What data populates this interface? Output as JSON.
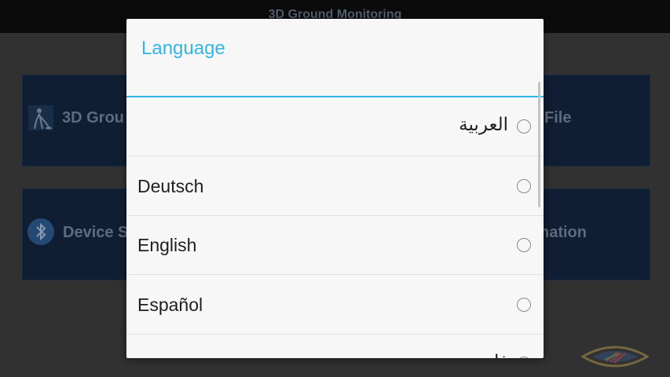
{
  "app": {
    "title": "3D Ground Monitoring"
  },
  "tiles": {
    "top_left_label": "3D Grou",
    "top_right_label": "File",
    "bottom_left_label": "Device S",
    "bottom_right_label": "nation"
  },
  "dialog": {
    "title": "Language",
    "options": [
      {
        "label": "العربية",
        "dir": "rtl",
        "selected": false
      },
      {
        "label": "Deutsch",
        "dir": "ltr",
        "selected": false
      },
      {
        "label": "English",
        "dir": "ltr",
        "selected": false
      },
      {
        "label": "Español",
        "dir": "ltr",
        "selected": false
      },
      {
        "label": "فارسی",
        "dir": "rtl",
        "selected": false
      }
    ]
  },
  "colors": {
    "accent": "#33b5e5",
    "tile_bg": "#13243d",
    "topbar_bg": "#0e0e0e"
  },
  "icons": {
    "tile1": "metal-detector-person-icon",
    "tile3": "bluetooth-icon",
    "corner": "eye-logo-icon"
  }
}
